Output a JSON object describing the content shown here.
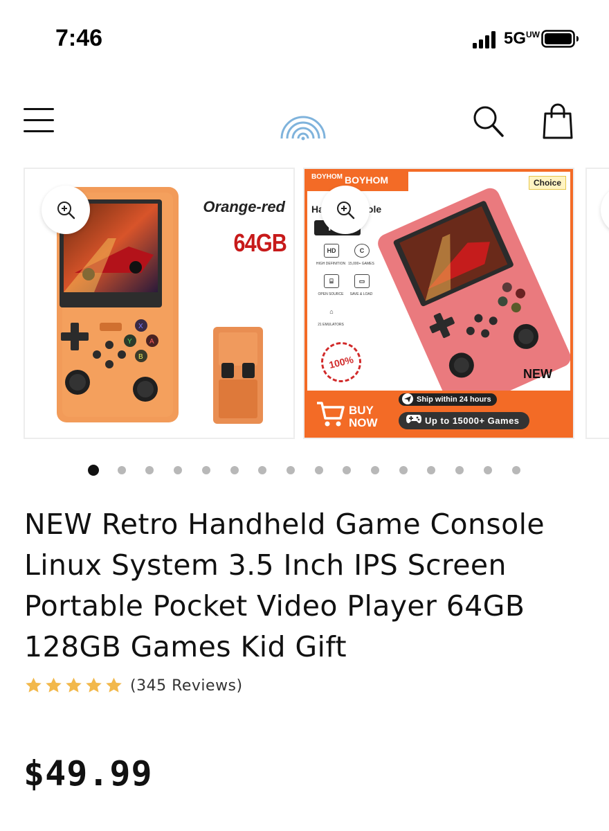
{
  "status_bar": {
    "time": "7:46",
    "network": "5G",
    "network_sup": "UW",
    "battery_icon": "battery-icon",
    "signal_icon": "cellular-signal-icon"
  },
  "header": {
    "menu_icon": "hamburger-menu-icon",
    "logo_icon": "rainbow-arc-logo-icon",
    "search_icon": "search-icon",
    "cart_icon": "shopping-bag-icon"
  },
  "gallery": {
    "slide1": {
      "color_label": "Orange-red",
      "capacity_label": "64GB"
    },
    "slide2": {
      "brand": "BOYHOM",
      "brand_mark": "BOYHOM",
      "choice_badge": "Choice",
      "headline": "Ha         me Console",
      "model": "R  S",
      "features": [
        "HD",
        "HIGH DEFINITION",
        "15,000+ GAMES",
        "OPEN SOURCE",
        "SAVE & LOAD",
        "21 EMULATORS"
      ],
      "stamp": "100%",
      "new_label": "NEW",
      "buy_now": "BUY NOW",
      "ship_label": "Ship within 24 hours",
      "games_label": "Up to 15000+   Games"
    },
    "slide_count": 16,
    "active_index": 0
  },
  "product": {
    "title": "NEW Retro Handheld Game Console Linux System 3.5 Inch IPS Screen Portable Pocket Video Player 64GB 128GB Games Kid Gift",
    "rating_stars": 5,
    "reviews_label": "(345 Reviews)",
    "price": "$49.99"
  },
  "colors": {
    "star": "#f2b84b",
    "accent_orange": "#f36b26",
    "capacity_red": "#c71a1a",
    "logo_blue": "#7fb3dc"
  }
}
